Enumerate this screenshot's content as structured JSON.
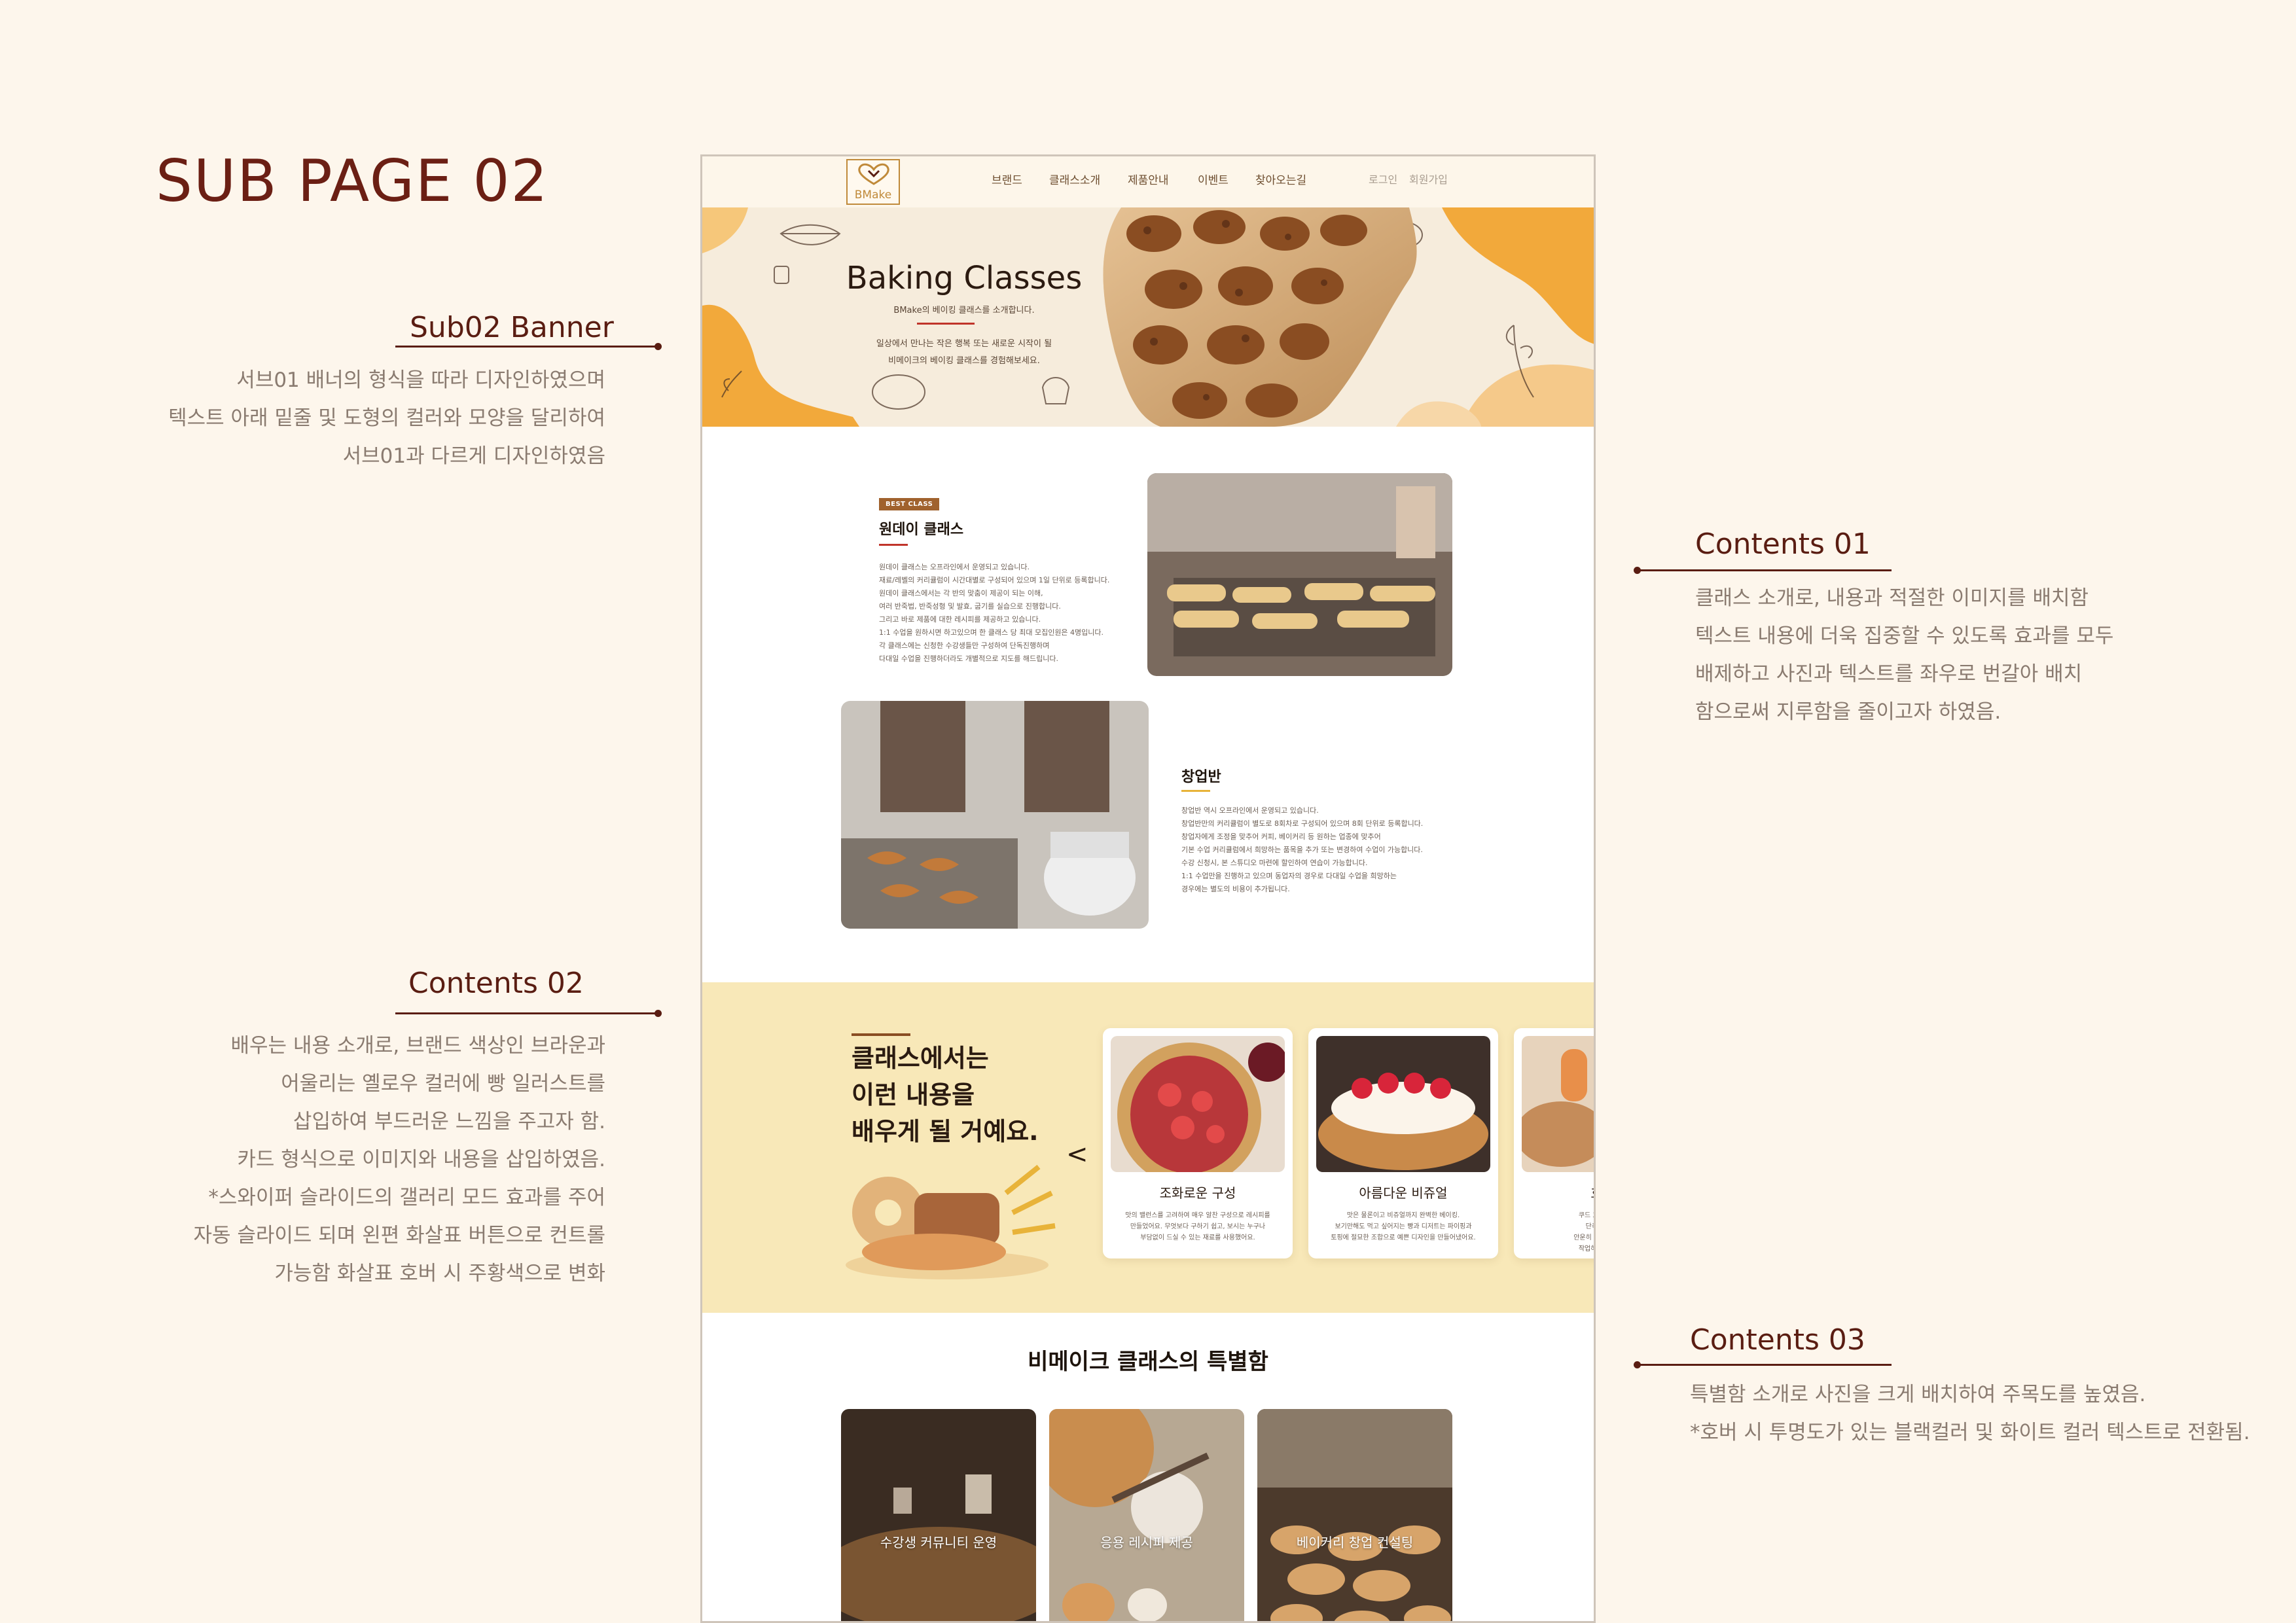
{
  "page_title": "SUB PAGE 02",
  "annotations": {
    "sub02_banner": {
      "heading": "Sub02 Banner",
      "text": "서브01 배너의 형식을 따라 디자인하였으며\n텍스트 아래 밑줄 및 도형의 컬러와 모양을 달리하여\n서브01과 다르게 디자인하였음"
    },
    "contents01": {
      "heading": "Contents 01",
      "text": "클래스 소개로, 내용과 적절한 이미지를 배치함\n텍스트 내용에 더욱 집중할 수 있도록 효과를 모두\n배제하고 사진과 텍스트를 좌우로 번갈아 배치\n함으로써 지루함을 줄이고자 하였음."
    },
    "contents02": {
      "heading": "Contents 02",
      "text": "배우는 내용 소개로, 브랜드 색상인 브라운과\n어울리는 옐로우 컬러에 빵 일러스트를\n삽입하여 부드러운 느낌을 주고자 함.\n카드 형식으로 이미지와 내용을 삽입하였음.\n*스와이퍼 슬라이드의 갤러리 모드 효과를 주어\n자동 슬라이드 되며 왼편 화살표 버튼으로 컨트롤\n가능함 화살표 호버 시 주황색으로 변화"
    },
    "contents03": {
      "heading": "Contents 03",
      "text": "특별함 소개로 사진을 크게 배치하여 주목도를 높였음.\n*호버 시 투명도가 있는 블랙컬러 및 화이트 컬러 텍스트로 전환됨."
    }
  },
  "site": {
    "logo_text": "BMake",
    "nav": [
      "브랜드",
      "클래스소개",
      "제품안내",
      "이벤트",
      "찾아오는길"
    ],
    "util": [
      "로그인",
      "회원가입"
    ],
    "banner": {
      "title": "Baking Classes",
      "subtitle": "BMake의 베이킹 클래스를 소개합니다.",
      "desc": "일상에서 만나는 작은 행복 또는 새로운 시작이 될\n비메이크의 베이킹 클래스를 경험해보세요."
    },
    "class1": {
      "badge": "BEST CLASS",
      "title": "원데이 클래스",
      "body": "원데이 클래스는 오프라인에서 운영되고 있습니다.\n재료/레벨의 커리큘럼이 시간대별로 구성되어 있으며 1일 단위로 등록합니다.\n원데이 클래스에서는 각 반의 맞춤이 제공이 되는 이해,\n여러 반죽법, 반죽성형 및 발효, 굽기를 실습으로 진행합니다.\n그리고 바로 제품에 대한 레시피를 제공하고 있습니다.\n1:1 수업을 원하시면 하고있으며 한 클래스 당 최대 모집인원은 4명입니다.\n각 클래스에는 신청한 수강생들만 구성하여 단독진행하며\n다대일 수업을 진행하더라도 개별적으로 지도를 해드립니다."
    },
    "class2": {
      "title": "창업반",
      "body": "창업반 역시 오프라인에서 운영되고 있습니다.\n창업반만의 커리큘럼이 별도로 8회차로 구성되어 있으며 8회 단위로 등록합니다.\n창업자에게 조정을 맞추어 커피, 베이커리 등 원하는 업종에 맞추어\n기본 수업 커리큘럼에서 희망하는 품목을 추가 또는 변경하여 수업이 가능합니다.\n수강 신청시, 본 스튜디오 마련에 할인하여 연습이 가능합니다.\n1:1 수업만을 진행하고 있으며 동업자의 경우로 다대일 수업을 희망하는\n경우에는 별도의 비용이 추가됩니다."
    },
    "learn": {
      "title": "클래스에서는\n이런 내용을\n배우게 될 거예요.",
      "arrow": "<",
      "cards": [
        {
          "title": "조화로운 구성",
          "desc": "맛의 밸런스를 고려하여 매우 알찬 구성으로 레시피를\n만들었어요. 무엇보다 구하기 쉽고, 보시는 누구나\n부담없이 드실 수 있는 재료를 사용했어요."
        },
        {
          "title": "아름다운 비쥬얼",
          "desc": "맛은 물론이고 비쥬얼까지 완벽한 베이킹.\n보기만해도 먹고 싶어지는 빵과 디저트는 파이핑과\n토핑에 절묘한 조합으로 예쁜 디자인을 만들어냈어요."
        },
        {
          "title": "효율적",
          "desc": "쿠드 효율세서 통을 쉽\n단축시킬 수 있는 \n안운히 작업시간을 단축시\n작업하는 동안 좋은 실"
        }
      ]
    },
    "special": {
      "heading": "비메이크 클래스의 특별함",
      "items": [
        "수강생 커뮤니티 운영",
        "응용 레시피 제공",
        "베이커리 창업 컨설팅"
      ]
    }
  },
  "colors": {
    "brand_brown": "#5a1d12",
    "banner_orange": "#f2a93b",
    "yellow_bg": "#f8e8b8",
    "rule_red": "#c0342a",
    "rule_yellow": "#e8b339"
  }
}
